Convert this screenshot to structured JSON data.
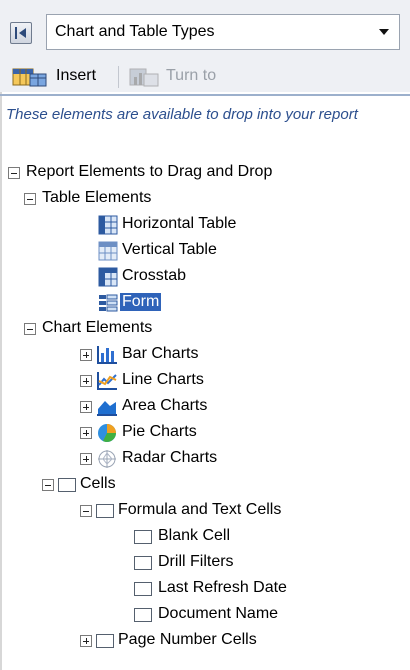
{
  "dropdown": {
    "value": "Chart and Table Types"
  },
  "toolbar": {
    "insert_label": "Insert",
    "turnto_label": "Turn to"
  },
  "hint": "These elements are available to drop into your report",
  "tree": {
    "root": "Report Elements to Drag and Drop",
    "table_elements": {
      "label": "Table Elements",
      "items": [
        "Horizontal Table",
        "Vertical Table",
        "Crosstab",
        "Form"
      ]
    },
    "chart_elements": {
      "label": "Chart Elements",
      "items": [
        "Bar Charts",
        "Line Charts",
        "Area Charts",
        "Pie Charts",
        "Radar Charts"
      ]
    },
    "cells": {
      "label": "Cells",
      "formula_text": {
        "label": "Formula and Text Cells",
        "items": [
          "Blank Cell",
          "Drill Filters",
          "Last Refresh Date",
          "Document Name"
        ]
      },
      "page_number": "Page Number Cells"
    }
  },
  "colors": {
    "selection": "#2f63b9",
    "hint_text": "#2c4f8e",
    "toolbar_bg": "#eef0f4"
  }
}
